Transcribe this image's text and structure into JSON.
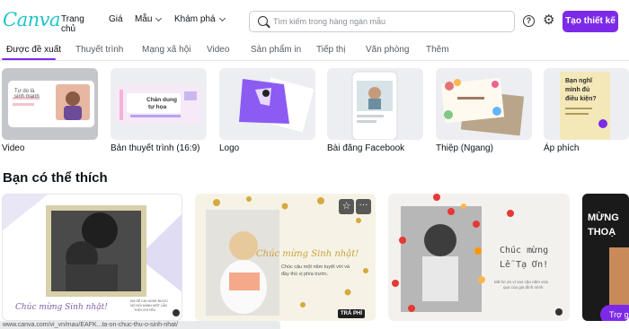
{
  "app": {
    "logo": "Canva",
    "brand_color": "#20c4cb",
    "accent_color": "#7d2ae8"
  },
  "header": {
    "nav": [
      "Trang chủ",
      "Giá",
      "Mẫu",
      "Khám phá"
    ],
    "search_placeholder": "Tìm kiếm trong hàng ngàn mẫu",
    "help_glyph": "?",
    "cta_label": "Tạo thiết kế"
  },
  "tabs": [
    "Được đề xuất",
    "Thuyết trình",
    "Mạng xã hội",
    "Video",
    "Sản phẩm in",
    "Tiếp thị",
    "Văn phòng",
    "Thêm"
  ],
  "categories": [
    {
      "label": "Video",
      "thumb_text": [
        "Tự do là",
        "sinh mạnh"
      ]
    },
    {
      "label": "Bản thuyết trình (16:9)",
      "thumb_text": [
        "Chân dung",
        "tự họa"
      ]
    },
    {
      "label": "Logo",
      "thumb_text": []
    },
    {
      "label": "Bài đăng Facebook",
      "thumb_text": []
    },
    {
      "label": "Thiệp (Ngang)",
      "thumb_text": []
    },
    {
      "label": "Áp phích",
      "thumb_text": [
        "Bạn nghĩ",
        "mình đủ",
        "điều kiện?"
      ]
    }
  ],
  "section_title": "Bạn có thể thích",
  "cards": [
    {
      "title": "Chúc mừng Sinh nhật!",
      "small": [
        "EM SẼ CHI NGHE ĐƯỢC",
        "NÓ NÓI HÀNH MỘT LẦN",
        "THÔI CHỈ YÊU"
      ]
    },
    {
      "title": "Chúc mừng Sinh nhật!",
      "small": [
        "Chúc cậu một năm tuyệt vời và",
        "đầy thú vị phía trước."
      ],
      "badge": "TRẢ PHÍ"
    },
    {
      "title_lines": [
        "Chúc mừng",
        "Lễ Tạ Ơn!"
      ],
      "small": [
        "Mã lời ơn vì sao cậu năm vừa",
        "qua của gia đình mình"
      ]
    },
    {
      "title_lines": [
        "MỪNG",
        "THOẠ"
      ],
      "button": "Trợ giú"
    }
  ],
  "status_url": "www.canva.com/vi_vn/mau/EAFK...ta-on-chuc-thu-o-sinh-nhat/"
}
